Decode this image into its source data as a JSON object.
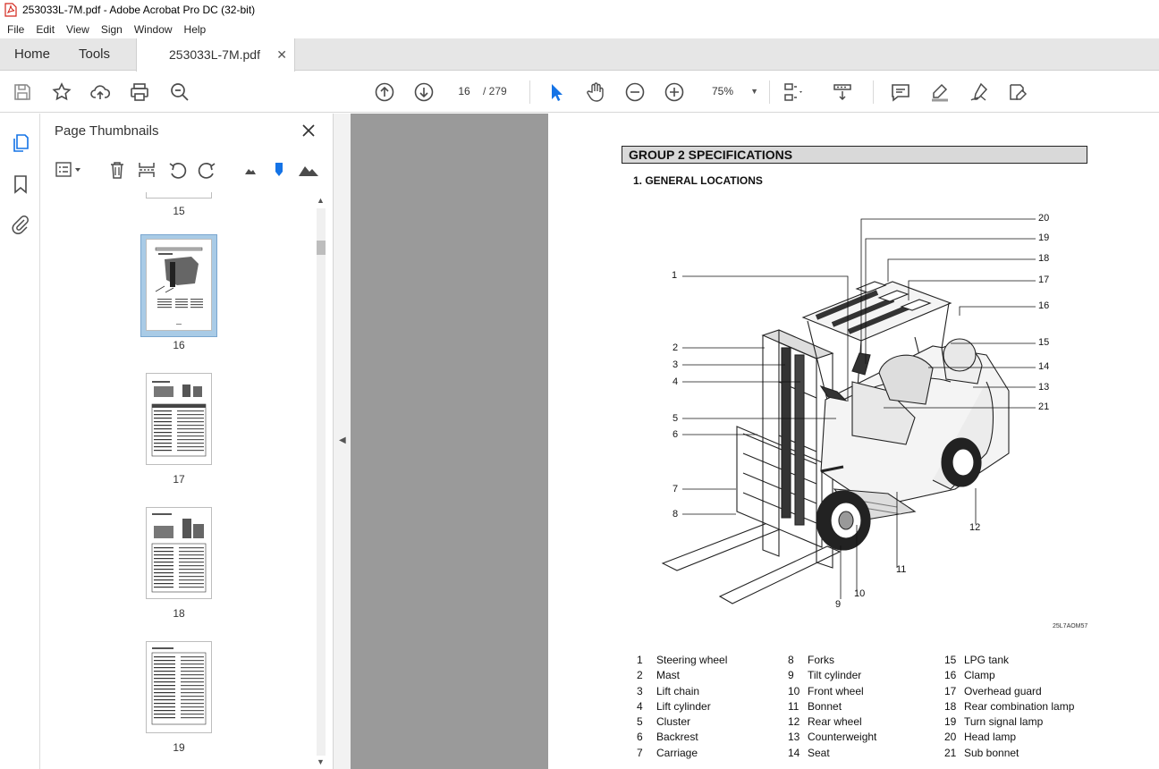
{
  "window": {
    "title": "253033L-7M.pdf - Adobe Acrobat Pro DC (32-bit)"
  },
  "menu": [
    "File",
    "Edit",
    "View",
    "Sign",
    "Window",
    "Help"
  ],
  "tabs": {
    "home": "Home",
    "tools": "Tools",
    "document": "253033L-7M.pdf"
  },
  "toolbar": {
    "page_current": "16",
    "page_total": "/   279",
    "zoom": "75%"
  },
  "thumbnails_panel": {
    "title": "Page Thumbnails",
    "pages": [
      "15",
      "16",
      "17",
      "18",
      "19"
    ],
    "selected_page": "16"
  },
  "document": {
    "group_heading": "GROUP 2 SPECIFICATIONS",
    "section_heading": "1. GENERAL LOCATIONS",
    "figure_code": "25L7AOM57",
    "callouts": [
      "1",
      "2",
      "3",
      "4",
      "5",
      "6",
      "7",
      "8",
      "9",
      "10",
      "11",
      "12",
      "13",
      "14",
      "15",
      "16",
      "17",
      "18",
      "19",
      "20",
      "21"
    ],
    "legend": [
      {
        "num": "1",
        "label": "Steering wheel"
      },
      {
        "num": "2",
        "label": "Mast"
      },
      {
        "num": "3",
        "label": "Lift chain"
      },
      {
        "num": "4",
        "label": "Lift cylinder"
      },
      {
        "num": "5",
        "label": "Cluster"
      },
      {
        "num": "6",
        "label": "Backrest"
      },
      {
        "num": "7",
        "label": "Carriage"
      },
      {
        "num": "8",
        "label": "Forks"
      },
      {
        "num": "9",
        "label": "Tilt cylinder"
      },
      {
        "num": "10",
        "label": "Front wheel"
      },
      {
        "num": "11",
        "label": "Bonnet"
      },
      {
        "num": "12",
        "label": "Rear wheel"
      },
      {
        "num": "13",
        "label": "Counterweight"
      },
      {
        "num": "14",
        "label": "Seat"
      },
      {
        "num": "15",
        "label": "LPG tank"
      },
      {
        "num": "16",
        "label": "Clamp"
      },
      {
        "num": "17",
        "label": "Overhead guard"
      },
      {
        "num": "18",
        "label": "Rear combination lamp"
      },
      {
        "num": "19",
        "label": "Turn signal lamp"
      },
      {
        "num": "20",
        "label": "Head lamp"
      },
      {
        "num": "21",
        "label": "Sub bonnet"
      }
    ]
  },
  "colors": {
    "accent_blue": "#1473e6",
    "doc_background": "#9a9a9a",
    "tab_bar": "#e6e6e6",
    "pdf_icon_red": "#d3261c"
  }
}
